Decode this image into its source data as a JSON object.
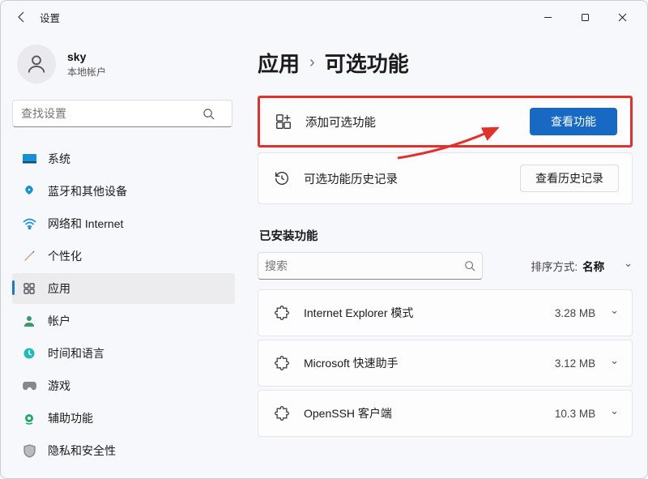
{
  "window": {
    "title": "设置",
    "minimize": "–",
    "maximize": "▢",
    "close": "✕"
  },
  "profile": {
    "name": "sky",
    "sub": "本地帐户"
  },
  "sidebar": {
    "search_placeholder": "查找设置",
    "items": [
      {
        "label": "系统",
        "color": "#1790d4"
      },
      {
        "label": "蓝牙和其他设备",
        "color": "#1790d4"
      },
      {
        "label": "网络和 Internet",
        "color": "#1790d4"
      },
      {
        "label": "个性化",
        "color": "#d77"
      },
      {
        "label": "应用",
        "color": "#666"
      },
      {
        "label": "帐户",
        "color": "#3a8"
      },
      {
        "label": "时间和语言",
        "color": "#2bb"
      },
      {
        "label": "游戏",
        "color": "#888"
      },
      {
        "label": "辅助功能",
        "color": "#2a6"
      },
      {
        "label": "隐私和安全性",
        "color": "#888"
      }
    ]
  },
  "breadcrumb": {
    "parent": "应用",
    "current": "可选功能"
  },
  "cards": {
    "add": {
      "label": "添加可选功能",
      "button": "查看功能"
    },
    "history": {
      "label": "可选功能历史记录",
      "button": "查看历史记录"
    }
  },
  "installed": {
    "title": "已安装功能",
    "search_placeholder": "搜索",
    "sort_label": "排序方式:",
    "sort_value": "名称",
    "items": [
      {
        "name": "Internet Explorer 模式",
        "size": "3.28 MB"
      },
      {
        "name": "Microsoft 快速助手",
        "size": "3.12 MB"
      },
      {
        "name": "OpenSSH 客户端",
        "size": "10.3 MB"
      }
    ]
  }
}
